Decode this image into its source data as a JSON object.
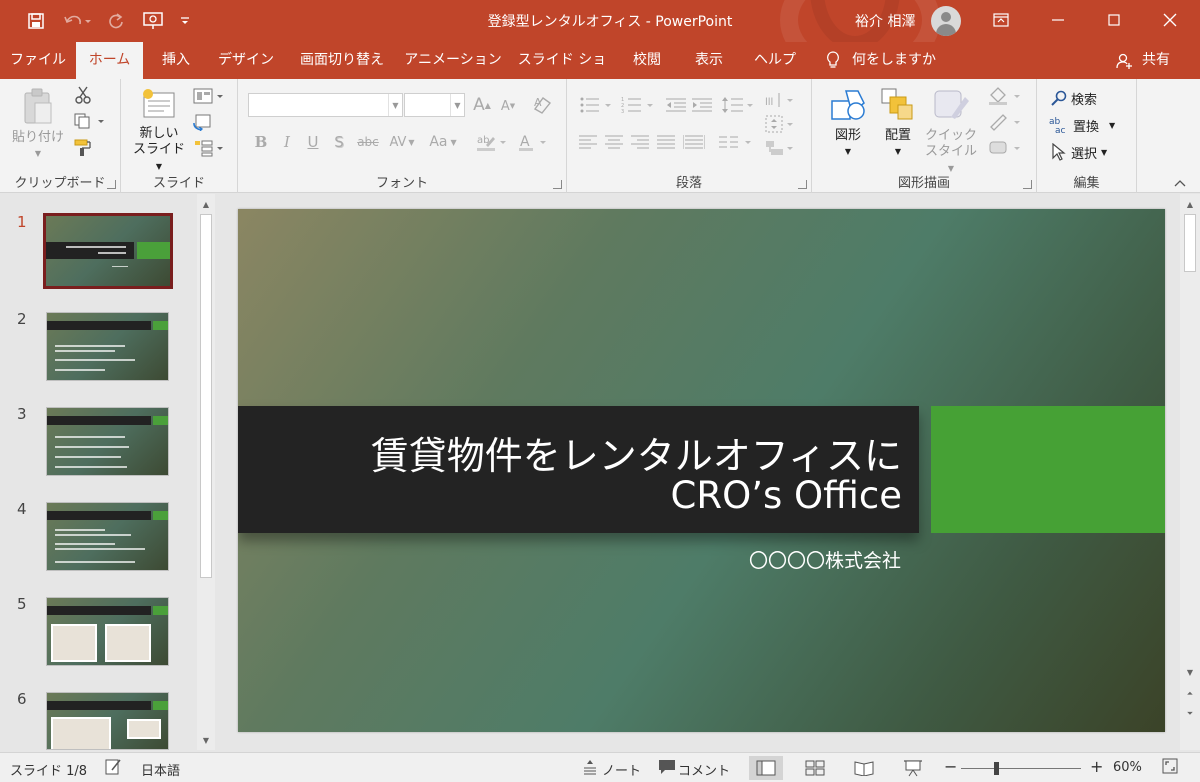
{
  "window": {
    "title": "登録型レンタルオフィス - PowerPoint",
    "user_name": "裕介 相澤"
  },
  "quick_access": [
    "save-icon",
    "undo-icon",
    "redo-icon",
    "present-from-start-icon",
    "customize-qat-icon"
  ],
  "tabs": [
    {
      "label": "ファイル"
    },
    {
      "label": "ホーム",
      "active": true
    },
    {
      "label": "挿入"
    },
    {
      "label": "デザイン"
    },
    {
      "label": "画面切り替え"
    },
    {
      "label": "アニメーション"
    },
    {
      "label": "スライド ショー"
    },
    {
      "label": "校閲"
    },
    {
      "label": "表示"
    },
    {
      "label": "ヘルプ"
    }
  ],
  "tell_me": "何をしますか",
  "share": "共有",
  "ribbon": {
    "clipboard": {
      "label": "クリップボード",
      "paste": "貼り付け"
    },
    "slides": {
      "label": "スライド",
      "new_slide_line1": "新しい",
      "new_slide_line2": "スライド"
    },
    "font": {
      "label": "フォント",
      "font_name": "",
      "font_size": "",
      "change_case": "Aa"
    },
    "paragraph": {
      "label": "段落"
    },
    "drawing": {
      "label": "図形描画",
      "shapes": "図形",
      "arrange": "配置",
      "quick_styles_line1": "クイック",
      "quick_styles_line2": "スタイル"
    },
    "editing": {
      "label": "編集",
      "find": "検索",
      "replace": "置換",
      "select": "選択"
    }
  },
  "thumbnails": [
    {
      "number": "1",
      "active": true
    },
    {
      "number": "2"
    },
    {
      "number": "3"
    },
    {
      "number": "4"
    },
    {
      "number": "5"
    },
    {
      "number": "6"
    }
  ],
  "slide": {
    "title_line1": "賃貸物件をレンタルオフィスに",
    "title_line2": "CRO’s Office",
    "subtitle": "〇〇〇〇株式会社"
  },
  "status": {
    "slide_indicator": "スライド 1/8",
    "language": "日本語",
    "notes": "ノート",
    "comments": "コメント",
    "zoom": "60%"
  },
  "colors": {
    "accent": "#c0452a",
    "slide_green": "#46a135",
    "slide_title_bar": "#232323"
  }
}
